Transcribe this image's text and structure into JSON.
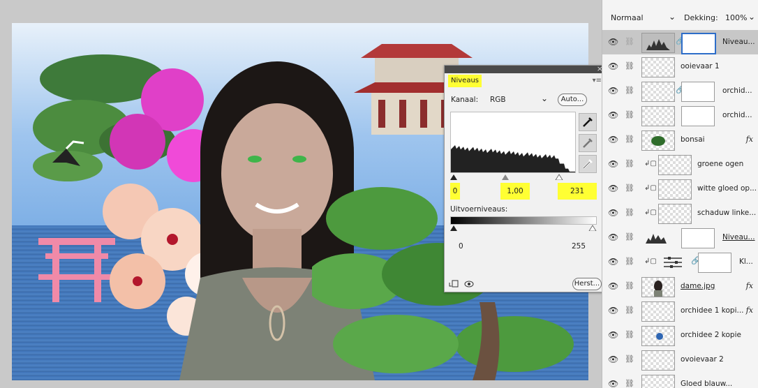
{
  "levels": {
    "tab": "Niveaus",
    "channel_label": "Kanaal:",
    "channel_value": "RGB",
    "auto_button": "Auto...",
    "input_black": "0",
    "input_gamma": "1,00",
    "input_white": "231",
    "output_label": "Uitvoerniveaus:",
    "output_low": "0",
    "output_high": "255",
    "reset_button": "Herst...",
    "close_glyph": "×",
    "menu_glyph": "▾≡",
    "highlight_color": "#ffff33"
  },
  "layers": {
    "blend_mode": "Normaal",
    "opacity_label": "Dekking:",
    "opacity_value": "100%",
    "items": [
      {
        "name": "Niveau...",
        "selected": true,
        "type": "adjustment"
      },
      {
        "name": "ooievaar 1"
      },
      {
        "name": "orchid..."
      },
      {
        "name": "orchid..."
      },
      {
        "name": "bonsai",
        "fx": "fx"
      },
      {
        "name": "groene ogen"
      },
      {
        "name": "witte gloed op..."
      },
      {
        "name": "schaduw linke..."
      },
      {
        "name": "Niveau...",
        "type": "adjustment"
      },
      {
        "name": "Kl..."
      },
      {
        "name": "dame.jpg",
        "fx": "fx"
      },
      {
        "name": "orchidee 1 kopi...",
        "fx": "fx"
      },
      {
        "name": "orchidee 2 kopie"
      },
      {
        "name": "ovoievaar 2"
      },
      {
        "name": "Gloed blauw..."
      }
    ]
  },
  "icons": {
    "eye": "eye-icon",
    "chain": "link-icon",
    "eyedropper": "eyedropper-icon",
    "chevron": "chevron-down-icon"
  }
}
